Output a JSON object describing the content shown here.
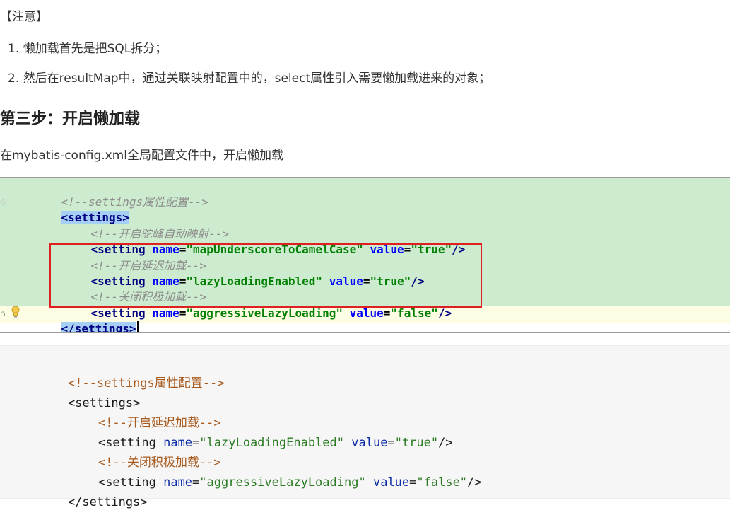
{
  "note": {
    "title": "【注意】"
  },
  "steps": [
    "1. 懒加载首先是把SQL拆分；",
    "2. 然后在resultMap中，通过关联映射配置中的，select属性引入需要懒加载进来的对象；"
  ],
  "heading": "第三步：开启懒加载",
  "intro": "在mybatis-config.xml全局配置文件中，开启懒加载",
  "ide": {
    "lines": [
      {
        "comment": "<!--settings属性配置-->"
      },
      {
        "open_tag": "<settings>"
      },
      {
        "comment": "<!--开启驼峰自动映射-->"
      },
      {
        "tag": "<setting",
        "attr1": "name",
        "val1": "\"mapUnderscoreToCamelCase\"",
        "attr2": "value",
        "val2": "\"true\"",
        "close": "/>"
      },
      {
        "comment": "<!--开启延迟加载-->"
      },
      {
        "tag": "<setting",
        "attr1": "name",
        "val1": "\"lazyLoadingEnabled\"",
        "attr2": "value",
        "val2": "\"true\"",
        "close": "/>"
      },
      {
        "comment": "<!--关闭积极加载-->"
      },
      {
        "tag": "<setting",
        "attr1": "name",
        "val1": "\"aggressiveLazyLoading\"",
        "attr2": "value",
        "val2": "\"false\"",
        "close": "/>"
      },
      {
        "close_tag": "</settings>"
      }
    ],
    "accent_colors": {
      "highlight_bg": "#cdeccf",
      "box": "#e02020"
    }
  },
  "code": {
    "lines": [
      {
        "comment": "<!--settings属性配置-->"
      },
      {
        "open_tag": "<settings>"
      },
      {
        "comment": "<!--开启延迟加载-->"
      },
      {
        "tag": "<setting",
        "attr1": "name",
        "val1": "\"lazyLoadingEnabled\"",
        "attr2": "value",
        "val2": "\"true\"",
        "close": "/>"
      },
      {
        "comment": "<!--关闭积极加载-->"
      },
      {
        "tag": "<setting",
        "attr1": "name",
        "val1": "\"aggressiveLazyLoading\"",
        "attr2": "value",
        "val2": "\"false\"",
        "close": "/>"
      },
      {
        "close_tag": "</settings>"
      }
    ]
  },
  "icons": [
    "fold-icon",
    "lightbulb-icon"
  ]
}
